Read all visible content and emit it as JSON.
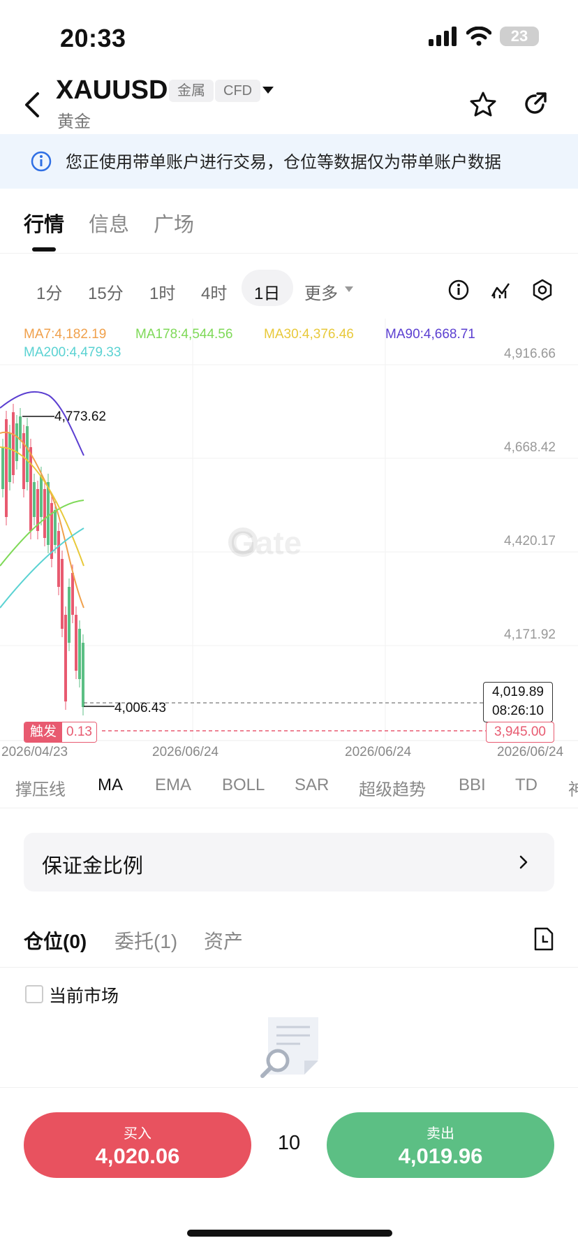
{
  "status_bar": {
    "time": "20:33",
    "battery": "23"
  },
  "header": {
    "symbol": "XAUUSD",
    "tag_category": "金属",
    "tag_type": "CFD",
    "subtitle": "黄金"
  },
  "notice": {
    "text": "您正使用带单账户进行交易，仓位等数据仅为带单账户数据"
  },
  "main_tabs": [
    "行情",
    "信息",
    "广场"
  ],
  "intervals": [
    "1分",
    "15分",
    "1时",
    "4时",
    "1日"
  ],
  "intervals_more": "更多",
  "chart": {
    "ma_legend": [
      {
        "label": "MA7:4,182.19",
        "color": "#f0a04b"
      },
      {
        "label": "MA178:4,544.56",
        "color": "#7ed957"
      },
      {
        "label": "MA30:4,376.46",
        "color": "#e8c93a"
      },
      {
        "label": "MA90:4,668.71",
        "color": "#5b3fd1"
      },
      {
        "label": "MA200:4,479.33",
        "color": "#5ad2d2"
      }
    ],
    "y_axis": [
      "4,916.66",
      "4,668.42",
      "4,420.17",
      "4,171.92"
    ],
    "high_label": "4,773.62",
    "low_label": "4,006.43",
    "current_price": "4,019.89",
    "countdown": "08:26:10",
    "trigger_label": "触发",
    "trigger_value": "0.13",
    "trigger_price": "3,945.00",
    "dates": [
      "2026/04/23",
      "2026/06/24",
      "2026/06/24",
      "2026/06/24"
    ],
    "watermark": "Gate"
  },
  "indicators": [
    "撑压线",
    "MA",
    "EMA",
    "BOLL",
    "SAR",
    "超级趋势",
    "BBI",
    "TD",
    "神"
  ],
  "margin_ratio": {
    "label": "保证金比例"
  },
  "position_tabs": [
    "仓位(0)",
    "委托(1)",
    "资产"
  ],
  "filter": {
    "label": "当前市场"
  },
  "trade": {
    "buy_label": "买入",
    "buy_price": "4,020.06",
    "quantity": "10",
    "sell_label": "卖出",
    "sell_price": "4,019.96"
  }
}
